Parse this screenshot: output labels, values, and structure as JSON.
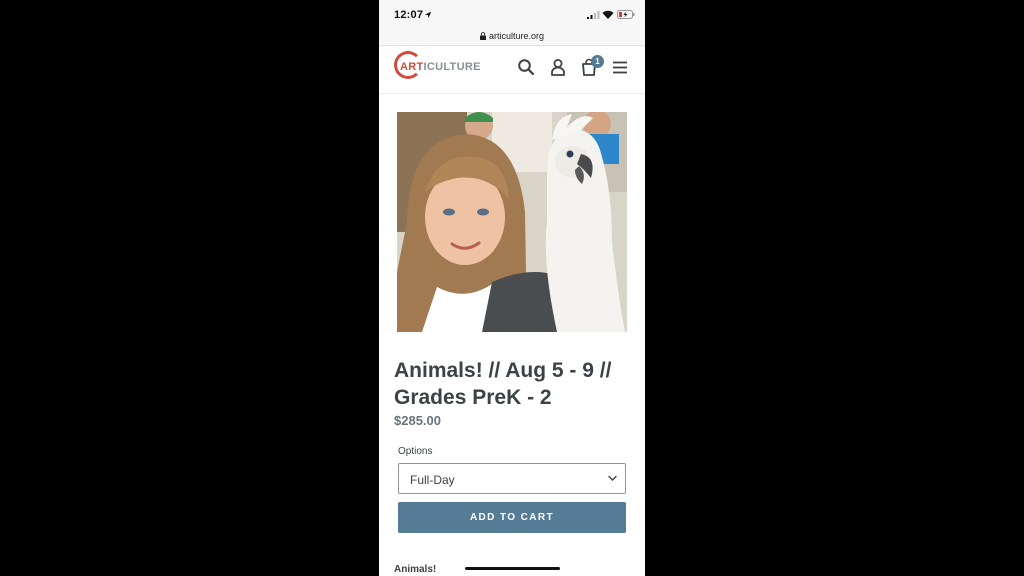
{
  "status_bar": {
    "time": "12:07",
    "url": "articulture.org"
  },
  "header": {
    "logo_art": "ART",
    "logo_rest": "ICULTURE",
    "cart_count": "1",
    "brand_color": "#d34b3c",
    "accent_color": "#557b97"
  },
  "product": {
    "title": "Animals! // Aug 5 - 9 // Grades PreK - 2",
    "price": "$285.00",
    "options_label": "Options",
    "selected_option": "Full-Day",
    "add_to_cart_label": "ADD TO CART",
    "description_heading": "Animals!"
  },
  "icons": [
    "location-icon",
    "signal-icon",
    "wifi-icon",
    "battery-icon",
    "lock-icon",
    "search-icon",
    "account-icon",
    "cart-icon",
    "menu-icon",
    "chevron-down-icon"
  ]
}
